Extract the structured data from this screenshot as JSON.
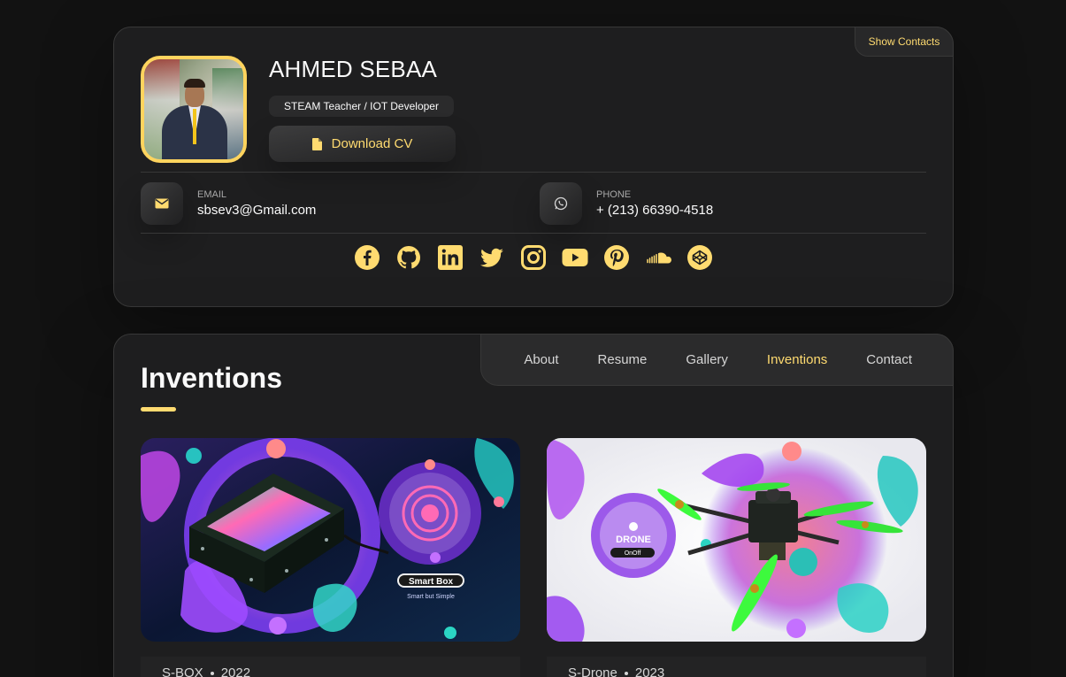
{
  "profile": {
    "show_contacts": "Show Contacts",
    "name": "AHMED SEBAA",
    "title": "STEAM Teacher / IOT Developer",
    "download_cv": "Download CV",
    "contacts": [
      {
        "title": "EMAIL",
        "value": "sbsev3@Gmail.com",
        "icon": "mail-icon"
      },
      {
        "title": "PHONE",
        "value": "+ (213) 66390-4518",
        "icon": "whatsapp-icon"
      }
    ],
    "socials": [
      "facebook",
      "github",
      "linkedin",
      "twitter",
      "instagram",
      "youtube",
      "pinterest",
      "soundcloud",
      "codepen"
    ]
  },
  "nav": {
    "items": [
      "About",
      "Resume",
      "Gallery",
      "Inventions",
      "Contact"
    ],
    "active": "Inventions"
  },
  "article": {
    "title": "Inventions",
    "projects": [
      {
        "name": "S-BOX",
        "year": "2022",
        "badge": "Smart Box",
        "tagline": "Smart but Simple"
      },
      {
        "name": "S-Drone",
        "year": "2023",
        "badge": "DRONE",
        "tagline": "OnOff"
      }
    ]
  },
  "colors": {
    "accent": "#ffdb70",
    "background": "#121212",
    "card": "#1e1e1f"
  }
}
